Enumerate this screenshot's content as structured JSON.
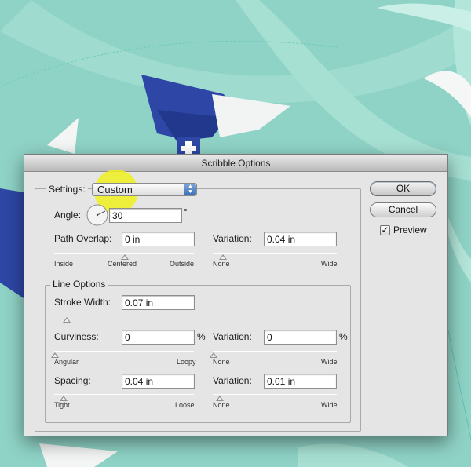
{
  "dialog": {
    "title": "Scribble Options",
    "settings_label": "Settings:",
    "settings_value": "Custom",
    "angle_label": "Angle:",
    "angle_value": "30",
    "angle_unit": "°",
    "path_overlap": {
      "label": "Path Overlap:",
      "value": "0 in",
      "ticks": [
        "Inside",
        "Centered",
        "Outside"
      ],
      "level": 0.5
    },
    "path_variation": {
      "label": "Variation:",
      "value": "0.04 in",
      "ticks": [
        "None",
        "Wide"
      ],
      "level": 0.05
    },
    "line_options": {
      "title": "Line Options",
      "stroke_width": {
        "label": "Stroke Width:",
        "value": "0.07 in",
        "level": 0.09
      },
      "curviness": {
        "label": "Curviness:",
        "value": "0",
        "unit": "%",
        "ticks": [
          "Angular",
          "Loopy"
        ],
        "level": 0.0
      },
      "curviness_variation": {
        "label": "Variation:",
        "value": "0",
        "unit": "%",
        "ticks": [
          "None",
          "Wide"
        ],
        "level": 0.0
      },
      "spacing": {
        "label": "Spacing:",
        "value": "0.04 in",
        "ticks": [
          "Tight",
          "Loose"
        ],
        "level": 0.07
      },
      "spacing_variation": {
        "label": "Variation:",
        "value": "0.01 in",
        "ticks": [
          "None",
          "Wide"
        ],
        "level": 0.05
      }
    },
    "buttons": {
      "ok": "OK",
      "cancel": "Cancel"
    },
    "preview": {
      "label": "Preview",
      "checked": true,
      "mark": "✓"
    }
  },
  "colors": {
    "background": "#8fd3c6",
    "highlight": "#f0f01e",
    "artwork_blue": "#2e47a6",
    "select_accent": "#3a6fb8"
  }
}
